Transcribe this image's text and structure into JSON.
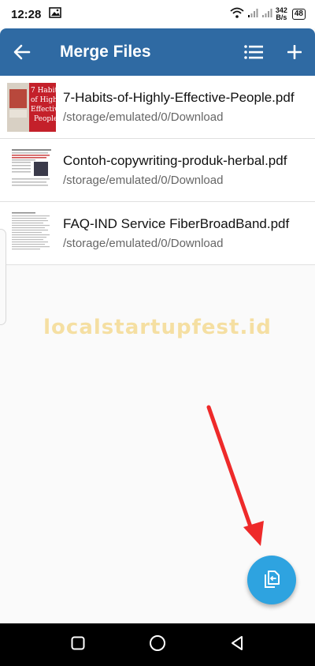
{
  "status_bar": {
    "time": "12:28",
    "net_speed_value": "342",
    "net_speed_unit": "B/s",
    "battery": "48"
  },
  "app_bar": {
    "title": "Merge Files",
    "back_icon": "arrow-left-icon",
    "list_icon": "list-icon",
    "add_icon": "plus-icon",
    "color": "#2f6aa3"
  },
  "files": [
    {
      "name": "7-Habits-of-Highly-Effective-People.pdf",
      "path": "/storage/emulated/0/Download"
    },
    {
      "name": "Contoh-copywriting-produk-herbal.pdf",
      "path": "/storage/emulated/0/Download"
    },
    {
      "name": "FAQ-IND Service FiberBroadBand.pdf",
      "path": "/storage/emulated/0/Download"
    }
  ],
  "watermark": "localstartupfest.id",
  "fab": {
    "icon": "merge-files-icon",
    "color": "#2ea3e0"
  },
  "nav_bar": {
    "icons": [
      "recent-apps-icon",
      "home-icon",
      "back-icon"
    ]
  }
}
